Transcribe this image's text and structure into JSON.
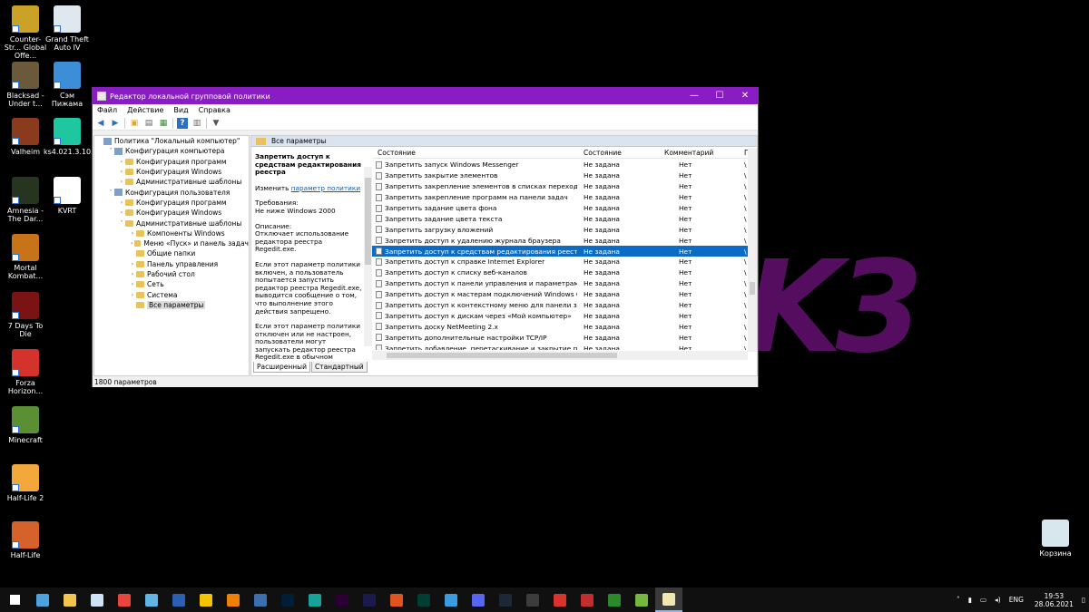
{
  "desktop": {
    "icons": [
      {
        "label": "Counter-Str... Global Offe...",
        "color": "#c9a227"
      },
      {
        "label": "Grand Theft Auto IV",
        "color": "#dfe7ef"
      },
      {
        "label": "Blacksad - Under t...",
        "color": "#6a5a3a"
      },
      {
        "label": "Сэм Пижама",
        "color": "#3c8fd6"
      },
      {
        "label": "Valheim",
        "color": "#8a3b1e"
      },
      {
        "label": "ks4.021.3.10...",
        "color": "#1fc7a0"
      },
      {
        "label": "Amnesia - The Dar...",
        "color": "#26351f"
      },
      {
        "label": "KVRT",
        "color": "#ffffff"
      },
      {
        "label": "Mortal Kombat...",
        "color": "#c7731a"
      },
      {
        "label": "7 Days To Die",
        "color": "#7a1414"
      },
      {
        "label": "Forza Horizon...",
        "color": "#d3332b"
      },
      {
        "label": "Minecraft",
        "color": "#5a8f33"
      },
      {
        "label": "Half-Life 2",
        "color": "#f2a83a"
      },
      {
        "label": "Half-Life",
        "color": "#d4622a"
      },
      {
        "label": "Корзина",
        "color": "#d8e6ee"
      }
    ],
    "bg_logo": "K3"
  },
  "window": {
    "title": "Редактор локальной групповой политики",
    "controls": {
      "minimize": "—",
      "maximize": "☐",
      "close": "✕"
    },
    "menu": [
      "Файл",
      "Действие",
      "Вид",
      "Справка"
    ],
    "tree": [
      {
        "label": "Политика \"Локальный компьютер\"",
        "level": 0,
        "arrow": "",
        "icon": "policy"
      },
      {
        "label": "Конфигурация компьютера",
        "level": 1,
        "arrow": "˅",
        "icon": "computer"
      },
      {
        "label": "Конфигурация программ",
        "level": 2,
        "arrow": "›",
        "icon": "folder"
      },
      {
        "label": "Конфигурация Windows",
        "level": 2,
        "arrow": "›",
        "icon": "folder"
      },
      {
        "label": "Административные шаблоны",
        "level": 2,
        "arrow": "›",
        "icon": "folder"
      },
      {
        "label": "Конфигурация пользователя",
        "level": 1,
        "arrow": "˅",
        "icon": "user"
      },
      {
        "label": "Конфигурация программ",
        "level": 2,
        "arrow": "›",
        "icon": "folder"
      },
      {
        "label": "Конфигурация Windows",
        "level": 2,
        "arrow": "›",
        "icon": "folder"
      },
      {
        "label": "Административные шаблоны",
        "level": 2,
        "arrow": "˅",
        "icon": "folder"
      },
      {
        "label": "Компоненты Windows",
        "level": 3,
        "arrow": "›",
        "icon": "folder"
      },
      {
        "label": "Меню «Пуск» и панель задач",
        "level": 3,
        "arrow": "›",
        "icon": "folder"
      },
      {
        "label": "Общие папки",
        "level": 3,
        "arrow": "",
        "icon": "folder"
      },
      {
        "label": "Панель управления",
        "level": 3,
        "arrow": "›",
        "icon": "folder"
      },
      {
        "label": "Рабочий стол",
        "level": 3,
        "arrow": "›",
        "icon": "folder"
      },
      {
        "label": "Сеть",
        "level": 3,
        "arrow": "›",
        "icon": "folder"
      },
      {
        "label": "Система",
        "level": 3,
        "arrow": "›",
        "icon": "folder"
      },
      {
        "label": "Все параметры",
        "level": 3,
        "arrow": "",
        "icon": "folder",
        "selected": true
      }
    ],
    "content_header": "Все параметры",
    "description": {
      "title": "Запретить доступ к средствам редактирования реестра",
      "edit_prefix": "Изменить",
      "edit_link": "параметр политики",
      "req_label": "Требования:",
      "req_value": "Не ниже Windows 2000",
      "desc_label": "Описание:",
      "desc_value": "Отключает использование редактора реестра Regedit.exe.",
      "para1": "Если этот параметр политики включен, а пользователь попытается запустить редактор реестра Regedit.exe, выводится сообщение о том, что выполнение этого действия запрещено.",
      "para2": "Если этот параметр политики отключен или не настроен, пользователи могут запускать редактор реестра Regedit.exe в обычном режиме."
    },
    "list_headers": {
      "name": "Состояние",
      "state": "Состояние",
      "comment": "Комментарий",
      "extra": "П"
    },
    "rows": [
      {
        "name": "Запретить запуск Windows Messenger",
        "state": "Не задана",
        "comment": "Нет",
        "extra": "\\"
      },
      {
        "name": "Запретить закрытие элементов",
        "state": "Не задана",
        "comment": "Нет",
        "extra": "\\"
      },
      {
        "name": "Запретить закрепление элементов в списках переходов",
        "state": "Не задана",
        "comment": "Нет",
        "extra": "\\"
      },
      {
        "name": "Запретить закрепление программ на панели задач",
        "state": "Не задана",
        "comment": "Нет",
        "extra": "\\"
      },
      {
        "name": "Запретить задание цвета фона",
        "state": "Не задана",
        "comment": "Нет",
        "extra": "\\"
      },
      {
        "name": "Запретить задание цвета текста",
        "state": "Не задана",
        "comment": "Нет",
        "extra": "\\"
      },
      {
        "name": "Запретить загрузку вложений",
        "state": "Не задана",
        "comment": "Нет",
        "extra": "\\"
      },
      {
        "name": "Запретить доступ к удалению журнала браузера",
        "state": "Не задана",
        "comment": "Нет",
        "extra": "\\"
      },
      {
        "name": "Запретить доступ к средствам редактирования реестра",
        "state": "Не задана",
        "comment": "Нет",
        "extra": "\\",
        "selected": true
      },
      {
        "name": "Запретить доступ к справке Internet Explorer",
        "state": "Не задана",
        "comment": "Нет",
        "extra": "\\"
      },
      {
        "name": "Запретить доступ к списку веб-каналов",
        "state": "Не задана",
        "comment": "Нет",
        "extra": "\\"
      },
      {
        "name": "Запретить доступ к панели управления и параметрам ко...",
        "state": "Не задана",
        "comment": "Нет",
        "extra": "\\"
      },
      {
        "name": "Запретить доступ к мастерам подключений Windows Co...",
        "state": "Не задана",
        "comment": "Нет",
        "extra": "\\"
      },
      {
        "name": "Запретить доступ к контекстному меню для панели задач",
        "state": "Не задана",
        "comment": "Нет",
        "extra": "\\"
      },
      {
        "name": "Запретить доступ к дискам через «Мой компьютер»",
        "state": "Не задана",
        "comment": "Нет",
        "extra": "\\"
      },
      {
        "name": "Запретить доску NetMeeting 2.x",
        "state": "Не задана",
        "comment": "Нет",
        "extra": "\\"
      },
      {
        "name": "Запретить дополнительные настройки TCP/IP",
        "state": "Не задана",
        "comment": "Нет",
        "extra": "\\"
      },
      {
        "name": "Запретить добавление, перетаскивание и закрытие пане...",
        "state": "Не задана",
        "comment": "Нет",
        "extra": "\\"
      }
    ],
    "tabs": [
      "Расширенный",
      "Стандартный"
    ],
    "status": "1800 параметров"
  },
  "taskbar": {
    "items": [
      {
        "name": "start",
        "color": "#ffffff"
      },
      {
        "name": "task-view",
        "color": "#4aa3df"
      },
      {
        "name": "explorer",
        "color": "#f2c64c"
      },
      {
        "name": "notepad",
        "color": "#cfe3f7"
      },
      {
        "name": "chrome",
        "color": "#e8453c"
      },
      {
        "name": "app-blue",
        "color": "#5fb6e6"
      },
      {
        "name": "word",
        "color": "#2b5fb4"
      },
      {
        "name": "app-yellow",
        "color": "#f5c400"
      },
      {
        "name": "vlc",
        "color": "#f08000"
      },
      {
        "name": "app-registry",
        "color": "#3c6fb0"
      },
      {
        "name": "photoshop",
        "color": "#001e36"
      },
      {
        "name": "app-teal",
        "color": "#17a398"
      },
      {
        "name": "premiere",
        "color": "#2a0033"
      },
      {
        "name": "after-effects",
        "color": "#1a1a4d"
      },
      {
        "name": "app-orange",
        "color": "#e0541e"
      },
      {
        "name": "audition",
        "color": "#003d33"
      },
      {
        "name": "app-network",
        "color": "#3a9be0"
      },
      {
        "name": "discord",
        "color": "#5865f2"
      },
      {
        "name": "steam",
        "color": "#1b2838"
      },
      {
        "name": "obs",
        "color": "#3c3c3c"
      },
      {
        "name": "app-red",
        "color": "#d9342b"
      },
      {
        "name": "app-flag",
        "color": "#c22d2d"
      },
      {
        "name": "xbox",
        "color": "#2a8a2a"
      },
      {
        "name": "utorrent",
        "color": "#76b83f"
      },
      {
        "name": "gpedit",
        "color": "#f0e8b0"
      }
    ],
    "lang": "ENG",
    "time": "19:53",
    "date": "28.06.2021"
  }
}
